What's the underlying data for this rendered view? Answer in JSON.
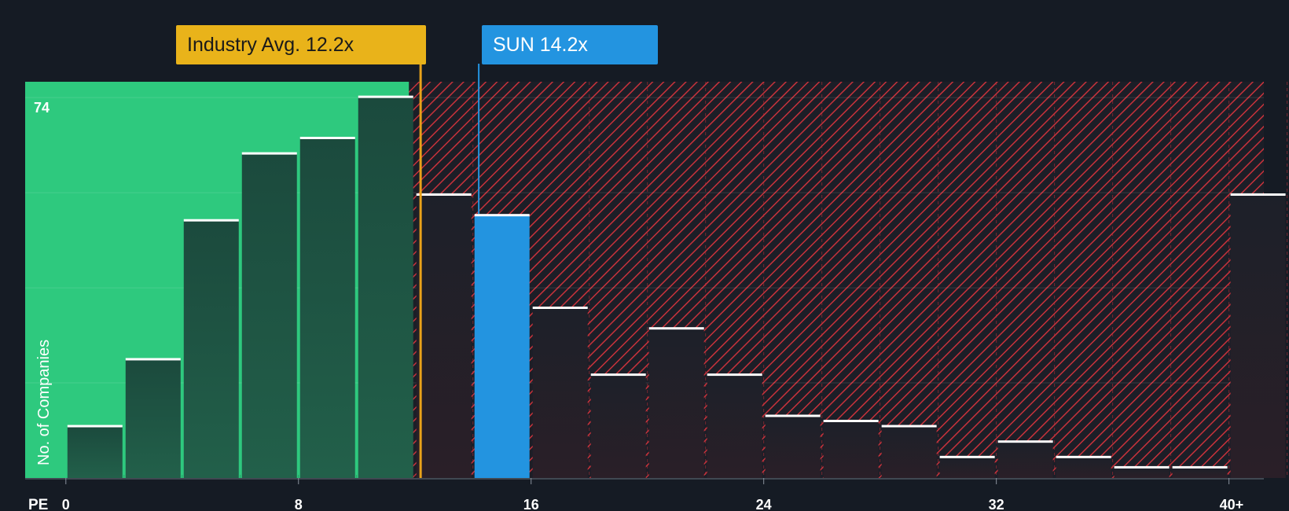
{
  "colors": {
    "background": "#151b24",
    "undervalued_zone": "#2ec97e",
    "overvalued_hatch": "#d5333d",
    "bar_in_green": "#1f4a3e",
    "bar_in_red": "#1f222b",
    "company_bar": "#2394e0",
    "industry_line": "#e9a21a",
    "bar_cap": "#ffffff"
  },
  "industry_label": "Industry Avg. 12.2x",
  "company_label": "SUN 14.2x",
  "chart_data": {
    "type": "bar",
    "xlabel": "PE",
    "ylabel": "No. of Companies",
    "x_ticks": [
      {
        "value": 0,
        "label": "0"
      },
      {
        "value": 8,
        "label": "8"
      },
      {
        "value": 16,
        "label": "16"
      },
      {
        "value": 24,
        "label": "24"
      },
      {
        "value": 32,
        "label": "32"
      },
      {
        "value": 40,
        "label": "40+"
      }
    ],
    "y_max_label": "74",
    "ylim": [
      0,
      77
    ],
    "xlim": [
      -1.4,
      41.2
    ],
    "industry_avg": 12.2,
    "company_value": 14.2,
    "company_bin_index": 7,
    "bins": [
      {
        "start": 0,
        "value": 10
      },
      {
        "start": 2,
        "value": 23
      },
      {
        "start": 4,
        "value": 50
      },
      {
        "start": 6,
        "value": 63
      },
      {
        "start": 8,
        "value": 66
      },
      {
        "start": 10,
        "value": 74
      },
      {
        "start": 12,
        "value": 55
      },
      {
        "start": 14,
        "value": 51
      },
      {
        "start": 16,
        "value": 33
      },
      {
        "start": 18,
        "value": 20
      },
      {
        "start": 20,
        "value": 29
      },
      {
        "start": 22,
        "value": 20
      },
      {
        "start": 24,
        "value": 12
      },
      {
        "start": 26,
        "value": 11
      },
      {
        "start": 28,
        "value": 10
      },
      {
        "start": 30,
        "value": 4
      },
      {
        "start": 32,
        "value": 7
      },
      {
        "start": 34,
        "value": 4
      },
      {
        "start": 36,
        "value": 2
      },
      {
        "start": 38,
        "value": 2
      },
      {
        "start": 40,
        "value": 55
      }
    ]
  }
}
